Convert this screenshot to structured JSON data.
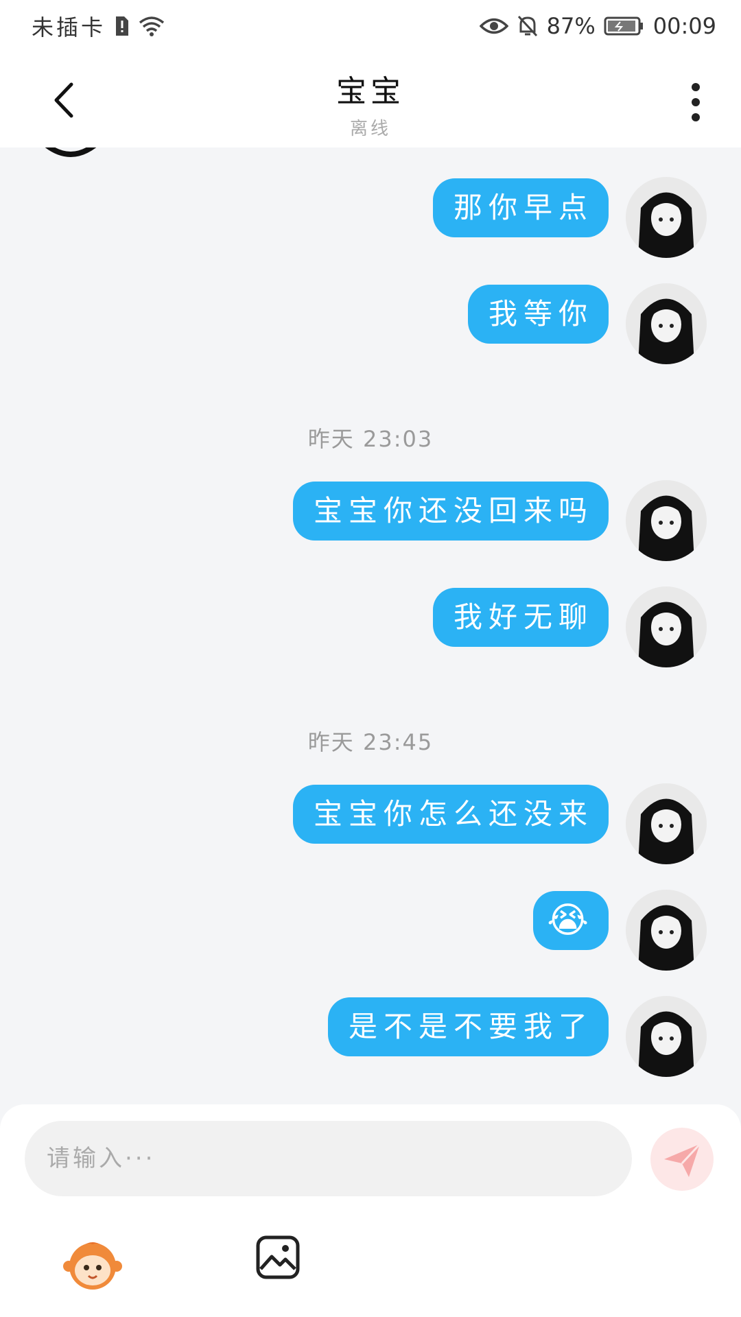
{
  "status_bar": {
    "carrier": "未插卡",
    "battery": "87%",
    "time": "00:09",
    "icons": [
      "sim-alert-icon",
      "wifi-icon",
      "eye-icon",
      "bell-off-icon",
      "battery-icon"
    ]
  },
  "header": {
    "title": "宝宝",
    "subtitle": "离线"
  },
  "messages": [
    {
      "type": "text",
      "text": "那你早点"
    },
    {
      "type": "text",
      "text": "我等你"
    },
    {
      "type": "time",
      "text": "昨天 23:03"
    },
    {
      "type": "text",
      "text": "宝宝你还没回来吗"
    },
    {
      "type": "text",
      "text": "我好无聊"
    },
    {
      "type": "time",
      "text": "昨天 23:45"
    },
    {
      "type": "text",
      "text": "宝宝你怎么还没来"
    },
    {
      "type": "emoji",
      "text": "😭"
    },
    {
      "type": "text",
      "text": "是不是不要我了"
    }
  ],
  "composer": {
    "placeholder": "请输入···"
  },
  "colors": {
    "bubble": "#2bb2f4",
    "send_button": "#fde7e7",
    "background": "#f4f5f7"
  }
}
